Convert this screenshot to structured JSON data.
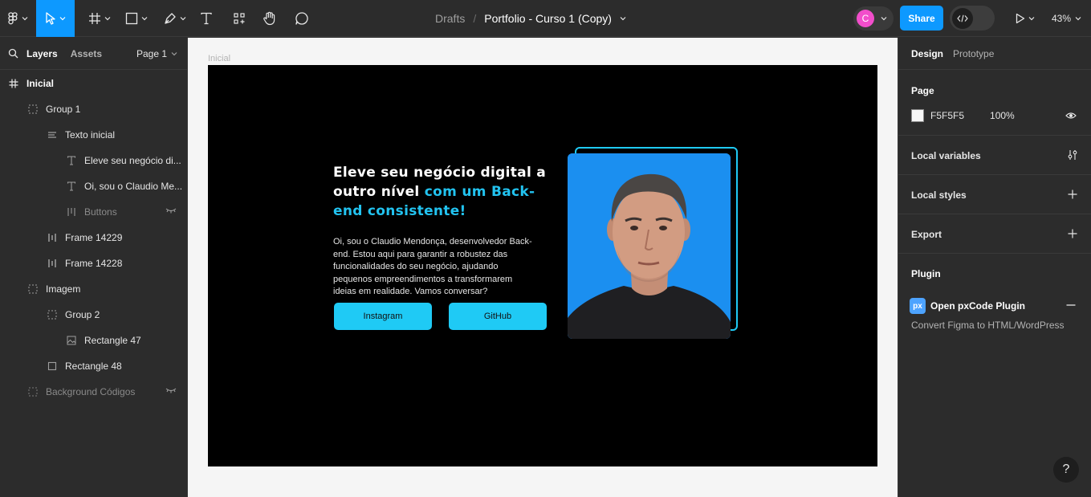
{
  "toolbar": {
    "breadcrumb_root": "Drafts",
    "breadcrumb_sep": "/",
    "file_name": "Portfolio - Curso 1 (Copy)",
    "avatar_initial": "C",
    "share_label": "Share",
    "zoom_label": "43%"
  },
  "left_panel": {
    "tab_layers": "Layers",
    "tab_assets": "Assets",
    "page_selector": "Page 1",
    "layers": [
      {
        "label": "Inicial",
        "icon": "frame-hash-icon"
      },
      {
        "label": "Group 1",
        "icon": "group-icon"
      },
      {
        "label": "Texto inicial",
        "icon": "auto-layout-vertical-icon"
      },
      {
        "label": "Eleve seu negócio di...",
        "icon": "text-icon"
      },
      {
        "label": "Oi, sou o Claudio Me...",
        "icon": "text-icon"
      },
      {
        "label": "Buttons",
        "icon": "auto-layout-horizontal-icon",
        "hidden": true
      },
      {
        "label": "Frame 14229",
        "icon": "auto-layout-horizontal-icon"
      },
      {
        "label": "Frame 14228",
        "icon": "auto-layout-horizontal-icon"
      },
      {
        "label": "Imagem",
        "icon": "group-icon"
      },
      {
        "label": "Group 2",
        "icon": "group-icon"
      },
      {
        "label": "Rectangle 47",
        "icon": "image-icon"
      },
      {
        "label": "Rectangle 48",
        "icon": "rectangle-icon"
      },
      {
        "label": "Background Códigos",
        "icon": "group-icon",
        "hidden": true
      }
    ]
  },
  "canvas": {
    "frame_label": "Inicial",
    "hero_title_part1": "Eleve seu negócio digital a outro nível ",
    "hero_title_accent": "com um Back-end consistente!",
    "hero_description": "Oi, sou o Claudio Mendonça, desenvolvedor Back-end. Estou aqui para garantir a robustez das funcionalidades do seu negócio, ajudando pequenos empreendimentos a transformarem ideias em realidade. Vamos conversar?",
    "button_instagram": "Instagram",
    "button_github": "GitHub",
    "colors": {
      "accent": "#1fcaf5",
      "frame_bg": "#000000",
      "photo_bg": "#1b8ff0"
    }
  },
  "right_panel": {
    "tab_design": "Design",
    "tab_prototype": "Prototype",
    "page_section_title": "Page",
    "page_color_hex": "F5F5F5",
    "page_opacity": "100%",
    "local_variables": "Local variables",
    "local_styles": "Local styles",
    "export": "Export",
    "plugin_section_title": "Plugin",
    "plugin_badge": "px",
    "plugin_name": "Open pxCode Plugin",
    "plugin_description": "Convert Figma to HTML/WordPress",
    "help": "?"
  }
}
